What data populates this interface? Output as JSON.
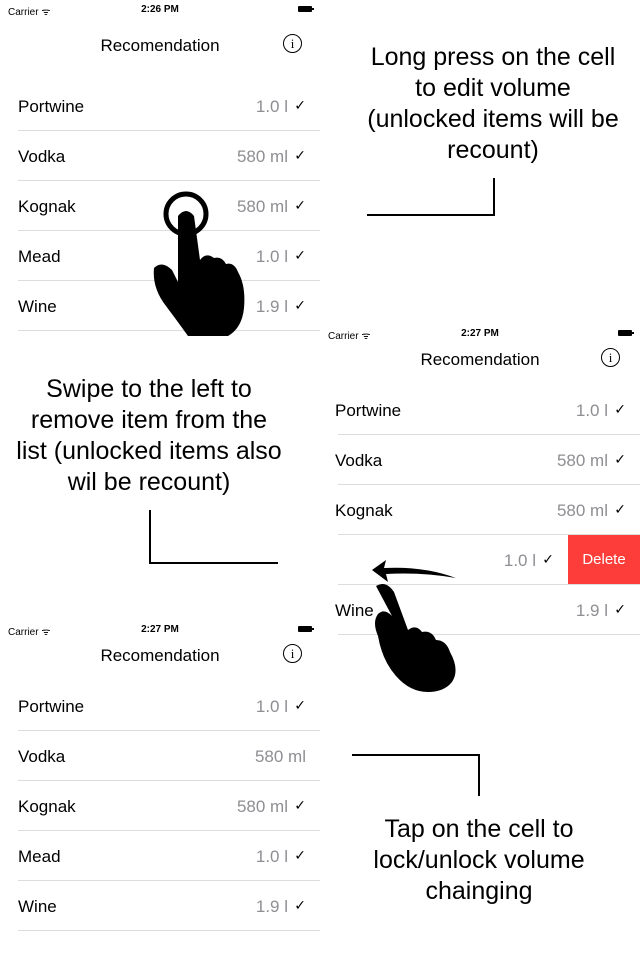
{
  "screens": [
    {
      "status": {
        "carrier": "Carrier ᯤ",
        "time": "2:26 PM"
      },
      "title": "Recomendation",
      "info": "i",
      "rows": [
        {
          "name": "Portwine",
          "volume": "1.0 l",
          "check": "✓"
        },
        {
          "name": "Vodka",
          "volume": "580 ml",
          "check": "✓"
        },
        {
          "name": "Kognak",
          "volume": "580 ml",
          "check": "✓"
        },
        {
          "name": "Mead",
          "volume": "1.0 l",
          "check": "✓"
        },
        {
          "name": "Wine",
          "volume": "1.9 l",
          "check": "✓"
        }
      ]
    },
    {
      "status": {
        "carrier": "Carrier ᯤ",
        "time": "2:27 PM"
      },
      "title": "Recomendation",
      "info": "i",
      "delete_label": "Delete",
      "rows": [
        {
          "name": "Portwine",
          "volume": "1.0 l",
          "check": "✓"
        },
        {
          "name": "Vodka",
          "volume": "580 ml",
          "check": "✓"
        },
        {
          "name": "Kognak",
          "volume": "580 ml",
          "check": "✓"
        },
        {
          "name": "",
          "volume": "1.0 l",
          "check": "✓"
        },
        {
          "name": "Wine",
          "volume": "1.9 l",
          "check": "✓"
        }
      ]
    },
    {
      "status": {
        "carrier": "Carrier ᯤ",
        "time": "2:27 PM"
      },
      "title": "Recomendation",
      "info": "i",
      "rows": [
        {
          "name": "Portwine",
          "volume": "1.0 l",
          "check": "✓"
        },
        {
          "name": "Vodka",
          "volume": "580 ml",
          "check": ""
        },
        {
          "name": "Kognak",
          "volume": "580 ml",
          "check": "✓"
        },
        {
          "name": "Mead",
          "volume": "1.0 l",
          "check": "✓"
        },
        {
          "name": "Wine",
          "volume": "1.9 l",
          "check": "✓"
        }
      ]
    }
  ],
  "captions": {
    "long_press": "Long press on the cell to edit volume (unlocked items will be recount)",
    "swipe": "Swipe to the left to remove item from the list (unlocked items also wil be recount)",
    "tap": "Tap on the cell to lock/unlock volume chainging"
  },
  "icons": [
    "info-icon",
    "wifi-icon",
    "battery-icon",
    "checkmark-icon",
    "hand-press-icon",
    "hand-swipe-icon"
  ],
  "colors": {
    "delete": "#fc3d39",
    "volume_text": "#8e8e93",
    "separator": "#dcdcdc"
  }
}
